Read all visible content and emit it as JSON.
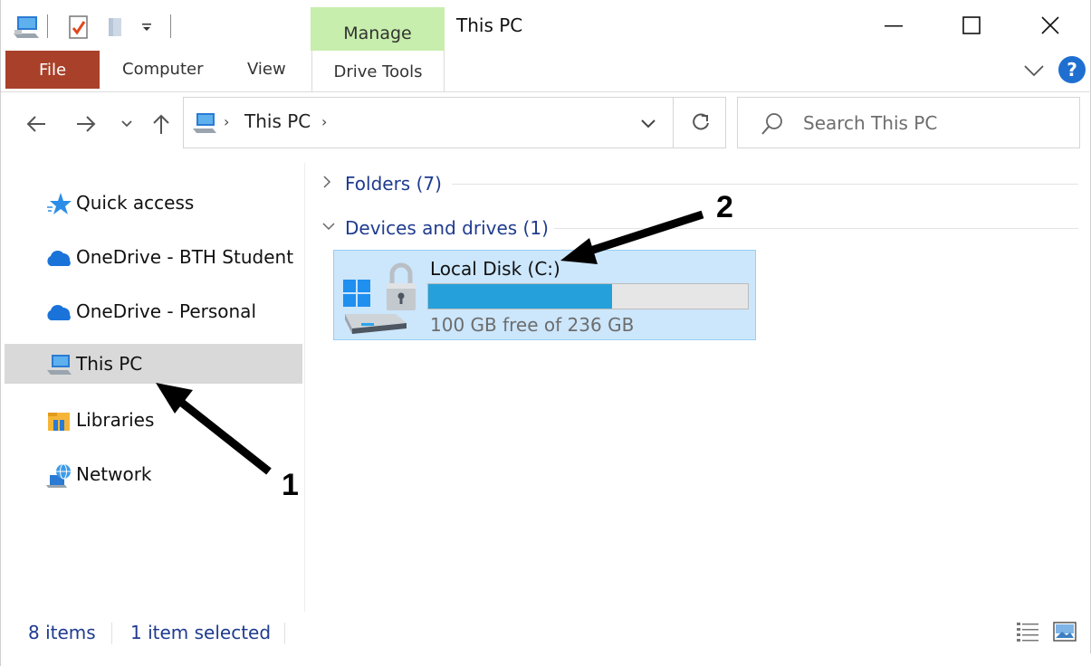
{
  "window": {
    "title": "This PC",
    "contextual_tab_group": "Manage",
    "minimize_icon": "minimize-icon",
    "maximize_icon": "maximize-icon",
    "close_icon": "close-icon"
  },
  "quick_access_toolbar": {
    "icons": [
      "this-pc-icon",
      "properties-icon",
      "new-folder-icon",
      "customize-dropdown-icon"
    ]
  },
  "ribbon": {
    "tabs": [
      {
        "label": "File"
      },
      {
        "label": "Computer"
      },
      {
        "label": "View"
      },
      {
        "label": "Drive Tools"
      }
    ],
    "help_label": "?"
  },
  "address": {
    "path": [
      "This PC"
    ],
    "search_placeholder": "Search This PC"
  },
  "navigation": {
    "items": [
      {
        "label": "Quick access",
        "icon": "quick-access-star-icon",
        "selected": false
      },
      {
        "label": "OneDrive - BTH Student",
        "icon": "onedrive-cloud-icon",
        "selected": false
      },
      {
        "label": "OneDrive - Personal",
        "icon": "onedrive-cloud-icon",
        "selected": false
      },
      {
        "label": "This PC",
        "icon": "this-pc-icon",
        "selected": true
      },
      {
        "label": "Libraries",
        "icon": "libraries-icon",
        "selected": false
      },
      {
        "label": "Network",
        "icon": "network-icon",
        "selected": false
      }
    ]
  },
  "content": {
    "groups": [
      {
        "label": "Folders (7)",
        "expanded": false
      },
      {
        "label": "Devices and drives (1)",
        "expanded": true
      }
    ],
    "drive": {
      "name": "Local Disk (C:)",
      "free_text": "100 GB free of 236 GB",
      "used_fraction": 0.576,
      "icon": "bitlocker-drive-icon",
      "selected": true
    }
  },
  "annotations": [
    {
      "label": "1",
      "points_to": "This PC"
    },
    {
      "label": "2",
      "points_to": "Local Disk (C:)"
    }
  ],
  "status_bar": {
    "item_count": "8 items",
    "selection": "1 item selected"
  },
  "colors": {
    "file_tab": "#a9402a",
    "manage_tab": "#c7eeac",
    "selection": "#cce6fb",
    "progress": "#26a0da",
    "link_text": "#1f3b8f"
  }
}
